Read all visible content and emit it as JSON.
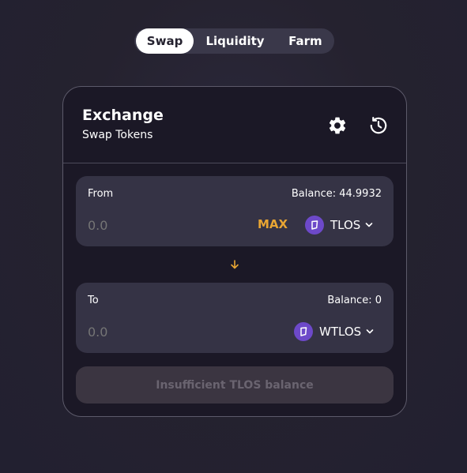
{
  "tabs": [
    {
      "label": "Swap",
      "active": true
    },
    {
      "label": "Liquidity",
      "active": false
    },
    {
      "label": "Farm",
      "active": false
    }
  ],
  "card": {
    "title": "Exchange",
    "subtitle": "Swap Tokens",
    "icons": [
      "gear-icon",
      "history-icon"
    ]
  },
  "from": {
    "label": "From",
    "balance": "Balance: 44.9932",
    "amount_placeholder": "0.0",
    "max_label": "MAX",
    "token": "TLOS"
  },
  "to": {
    "label": "To",
    "balance": "Balance: 0",
    "amount_placeholder": "0.0",
    "token": "WTLOS"
  },
  "submit_label": "Insufficient TLOS balance",
  "colors": {
    "accent": "#e8a533",
    "token_purple": "#6d49c9",
    "card_bg": "#1b1826",
    "panel_bg": "#353345"
  }
}
